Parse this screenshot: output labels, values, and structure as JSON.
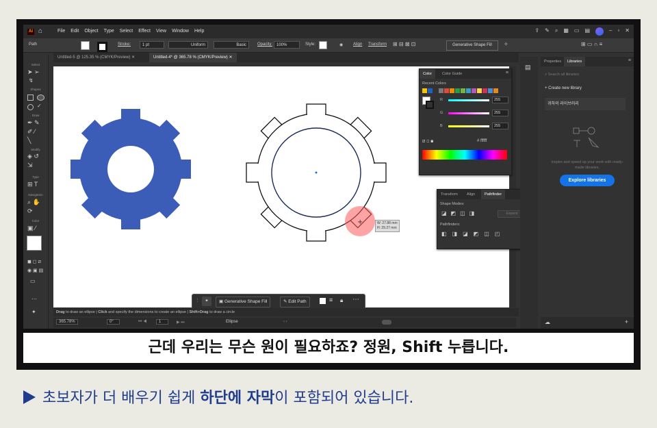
{
  "app": {
    "logo": "Ai",
    "menus": [
      "File",
      "Edit",
      "Object",
      "Type",
      "Select",
      "Effect",
      "View",
      "Window",
      "Help"
    ]
  },
  "control_bar": {
    "selection": "Path",
    "stroke_label": "Stroke:",
    "stroke_value": "1 pt",
    "profile": "Uniform",
    "brush": "Basic",
    "opacity_label": "Opacity:",
    "opacity_value": "100%",
    "style_label": "Style:",
    "align": "Align",
    "transform": "Transform",
    "shape_fill": "Generative Shape Fill"
  },
  "doc_tabs": [
    {
      "label": "Untitled-5 @ 125.35 % (CMYK/Preview)"
    },
    {
      "label": "Untitled-4* @ 365.78 % (CMYK/Preview)"
    }
  ],
  "tools": {
    "select": "Select",
    "shapes": "Shapes",
    "draw": "Draw",
    "modify": "Modify",
    "type": "Type",
    "navigation": "Navigation",
    "color": "Color"
  },
  "color_panel": {
    "tab_color": "Color",
    "tab_guide": "Color Guide",
    "recent": "Recent Colors",
    "r_label": "R",
    "g_label": "G",
    "b_label": "B",
    "r": "255",
    "g": "255",
    "b": "255",
    "hex": "ffffff",
    "recent_colors": [
      "#f5c400",
      "#1f5fc8",
      "#333333",
      "#7a7a7a",
      "#e04a3a",
      "#f08c00",
      "#2a9b4b",
      "#6fb644",
      "#36a0c8",
      "#b45ab4",
      "#ffd34d",
      "#cc3355",
      "#4d8bd9",
      "#e58a1f"
    ]
  },
  "pathfinder_panel": {
    "tab_transform": "Transform",
    "tab_align": "Align",
    "tab_pathfinder": "Pathfinder",
    "shape_modes": "Shape Modes:",
    "expand": "Expand",
    "pathfinders": "Pathfinders:"
  },
  "libraries": {
    "tab_properties": "Properties",
    "tab_libraries": "Libraries",
    "search_placeholder": "Search all libraries",
    "create": "Create new library",
    "library_name": "귀하의 라이브러리",
    "hint": "Inspire and speed up your work with ready-made libraries.",
    "explore": "Explore libraries"
  },
  "measure": {
    "w": "W: 27.88 mm",
    "h": "H: 29.27 mm"
  },
  "context_bar": {
    "shape_fill": "Generative Shape Fill",
    "edit_path": "Edit Path"
  },
  "status": {
    "drag": "Drag",
    "t1": " to draw an ellipse  |  ",
    "click": "Click",
    "t2": " and specify the dimensions to create an ellipse  |  ",
    "shift": "Shift+Drag",
    "t3": " to draw a circle"
  },
  "bottom_bar": {
    "zoom": "365.78%",
    "rotate": "0°",
    "artboard": "1",
    "tool": "Ellipse"
  },
  "caption": "근데 우리는 무슨 원이 필요하죠? 정원, Shift 누릅니다.",
  "footer": {
    "p1": "초보자가 더 배우기 쉽게 ",
    "bold": "하단에 자막",
    "p2": "이 포함되어 있습니다."
  },
  "colors": {
    "gear_blue": "#3b5db8",
    "accent": "#1473e6",
    "footer_blue": "#1f3d8c"
  }
}
